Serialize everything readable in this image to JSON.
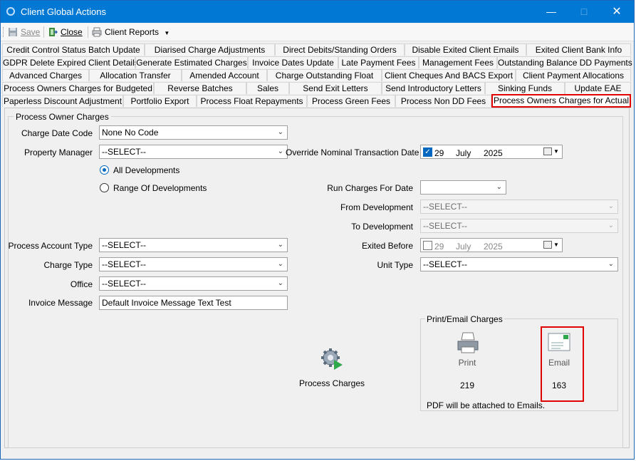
{
  "window": {
    "title": "Client Global Actions"
  },
  "toolbar": {
    "save_label": "Save",
    "close_label": "Close",
    "reports_label": "Client Reports"
  },
  "tabs": {
    "row1": [
      "Credit Control Status Batch Update",
      "Diarised Charge Adjustments",
      "Direct Debits/Standing Orders",
      "Disable Exited Client Emails",
      "Exited Client Bank Info"
    ],
    "row2": [
      "GDPR Delete Expired Client Details",
      "Generate Estimated Charges",
      "Invoice Dates Update",
      "Late Payment Fees",
      "Management Fees",
      "Outstanding Balance DD Payments"
    ],
    "row3": [
      "Advanced Charges",
      "Allocation Transfer",
      "Amended Account",
      "Charge Outstanding Float",
      "Client Cheques And BACS Export",
      "Client Payment Allocations"
    ],
    "row4": [
      "Process Owners Charges for Budgeted",
      "Reverse  Batches",
      "Sales",
      "Send Exit Letters",
      "Send Introductory Letters",
      "Sinking Funds",
      "Update EAE"
    ],
    "row5": [
      "Paperless Discount Adjustment",
      "Portfolio Export",
      "Process Float Repayments",
      "Process Green Fees",
      "Process Non DD Fees",
      "Process Owners Charges for Actual"
    ]
  },
  "form": {
    "group_title": "Process Owner Charges",
    "charge_date_code": {
      "label": "Charge Date Code",
      "value": "None No Code"
    },
    "property_manager": {
      "label": "Property Manager",
      "value": "--SELECT--"
    },
    "radio_all": "All Developments",
    "radio_range": "Range Of Developments",
    "override_date": {
      "label": "Override Nominal Transaction Date",
      "day": "29",
      "month": "July",
      "year": "2025"
    },
    "run_charges_for_date": {
      "label": "Run Charges For Date",
      "value": ""
    },
    "from_development": {
      "label": "From Development",
      "value": "--SELECT--"
    },
    "to_development": {
      "label": "To Development",
      "value": "--SELECT--"
    },
    "process_account_type": {
      "label": "Process Account Type",
      "value": "--SELECT--"
    },
    "exited_before": {
      "label": "Exited Before",
      "day": "29",
      "month": "July",
      "year": "2025"
    },
    "charge_type": {
      "label": "Charge Type",
      "value": "--SELECT--"
    },
    "unit_type": {
      "label": "Unit Type",
      "value": "--SELECT--"
    },
    "office": {
      "label": "Office",
      "value": "--SELECT--"
    },
    "invoice_message": {
      "label": "Invoice Message",
      "value": "Default Invoice Message Text Test"
    }
  },
  "process": {
    "label": "Process Charges"
  },
  "print_email": {
    "title": "Print/Email Charges",
    "print_label": "Print",
    "print_count": "219",
    "email_label": "Email",
    "email_count": "163",
    "note": "PDF will be attached to Emails."
  }
}
